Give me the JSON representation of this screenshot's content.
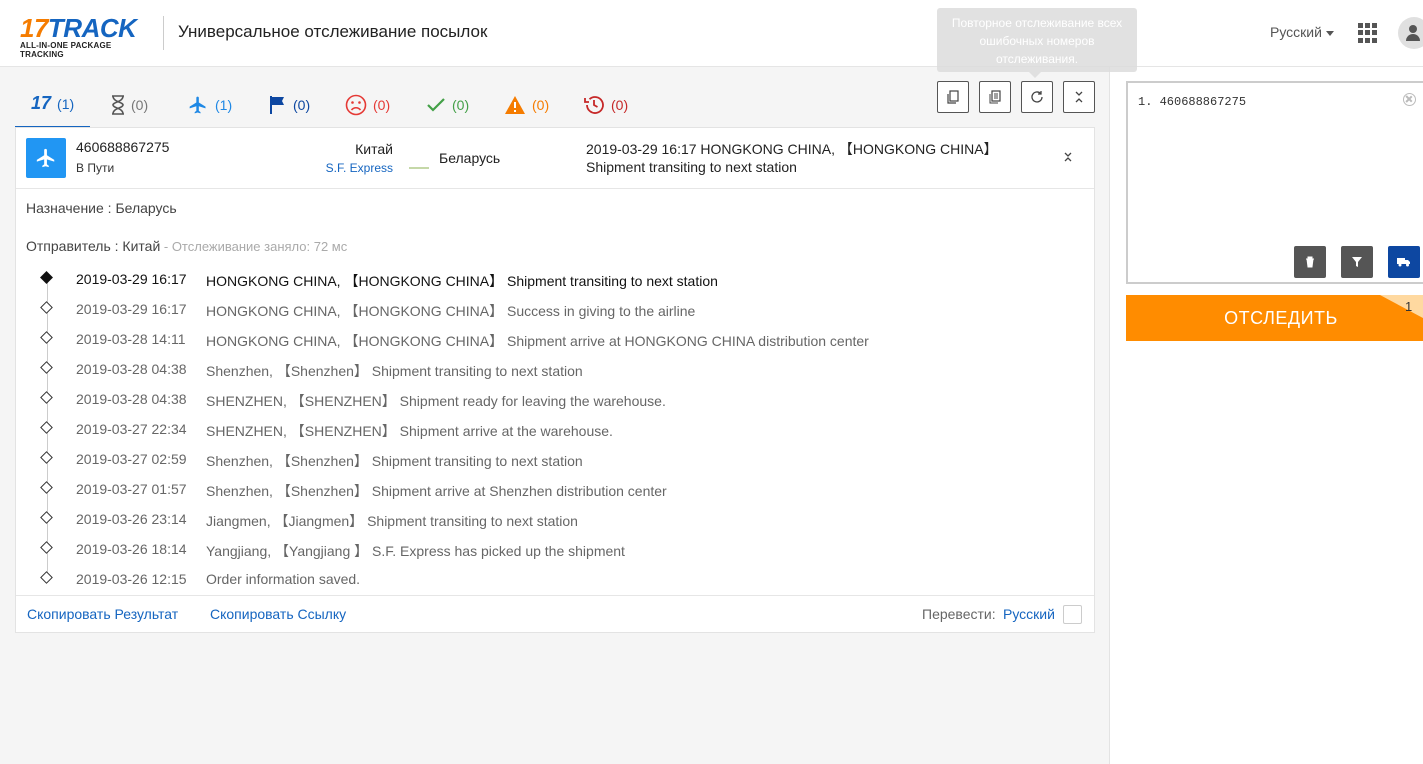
{
  "header": {
    "logo_main": "17TRACK",
    "logo_sub": "ALL-IN-ONE PACKAGE TRACKING",
    "title": "Универсальное отслеживание посылок",
    "language": "Русский"
  },
  "tooltip": {
    "text": "Повторное отслеживание всех ошибочных номеров отслеживания."
  },
  "tabs": [
    {
      "name": "all",
      "count": "(1)",
      "color": "#1565c0"
    },
    {
      "name": "not-found",
      "count": "(0)",
      "color": "#777777"
    },
    {
      "name": "in-transit",
      "count": "(1)",
      "color": "#1e88e5"
    },
    {
      "name": "pickup",
      "count": "(0)",
      "color": "#0d47a1"
    },
    {
      "name": "undelivered",
      "count": "(0)",
      "color": "#e53935"
    },
    {
      "name": "delivered",
      "count": "(0)",
      "color": "#43a047"
    },
    {
      "name": "alert",
      "count": "(0)",
      "color": "#f57c00"
    },
    {
      "name": "expired",
      "count": "(0)",
      "color": "#c62828"
    }
  ],
  "shipment": {
    "tracking_number": "460688867275",
    "status": "В Пути",
    "origin": "Китай",
    "carrier": "S.F. Express",
    "destination": "Беларусь",
    "last_event_line1": "2019-03-29 16:17  HONGKONG CHINA, 【HONGKONG CHINA】",
    "last_event_line2": "Shipment transiting to next station",
    "dest_label": "Назначение : Беларусь",
    "sender_label": "Отправитель : Китай",
    "took_time": " - Отслеживание заняло: 72 мс"
  },
  "events": [
    {
      "datetime": "2019-03-29 16:17",
      "desc": "HONGKONG CHINA, 【HONGKONG CHINA】 Shipment transiting to next station"
    },
    {
      "datetime": "2019-03-29 16:17",
      "desc": "HONGKONG CHINA, 【HONGKONG CHINA】 Success in giving to the airline"
    },
    {
      "datetime": "2019-03-28 14:11",
      "desc": "HONGKONG CHINA, 【HONGKONG CHINA】 Shipment arrive at HONGKONG CHINA distribution center"
    },
    {
      "datetime": "2019-03-28 04:38",
      "desc": "Shenzhen, 【Shenzhen】 Shipment transiting to next station"
    },
    {
      "datetime": "2019-03-28 04:38",
      "desc": "SHENZHEN, 【SHENZHEN】 Shipment ready for leaving the warehouse."
    },
    {
      "datetime": "2019-03-27 22:34",
      "desc": "SHENZHEN, 【SHENZHEN】 Shipment arrive at the warehouse."
    },
    {
      "datetime": "2019-03-27 02:59",
      "desc": "Shenzhen, 【Shenzhen】 Shipment transiting to next station"
    },
    {
      "datetime": "2019-03-27 01:57",
      "desc": "Shenzhen, 【Shenzhen】 Shipment arrive at Shenzhen distribution center"
    },
    {
      "datetime": "2019-03-26 23:14",
      "desc": "Jiangmen, 【Jiangmen】 Shipment transiting to next station"
    },
    {
      "datetime": "2019-03-26 18:14",
      "desc": "Yangjiang, 【Yangjiang 】 S.F. Express has picked up the shipment"
    },
    {
      "datetime": "2019-03-26 12:15",
      "desc": "Order information saved."
    }
  ],
  "footer": {
    "copy_result": "Скопировать Результат",
    "copy_link": "Скопировать Ссылку",
    "translate_label": "Перевести:",
    "translate_lang": "Русский"
  },
  "side": {
    "number_line": "1. 460688867275",
    "track_button": "ОТСЛЕДИТЬ",
    "badge_count": "1"
  }
}
